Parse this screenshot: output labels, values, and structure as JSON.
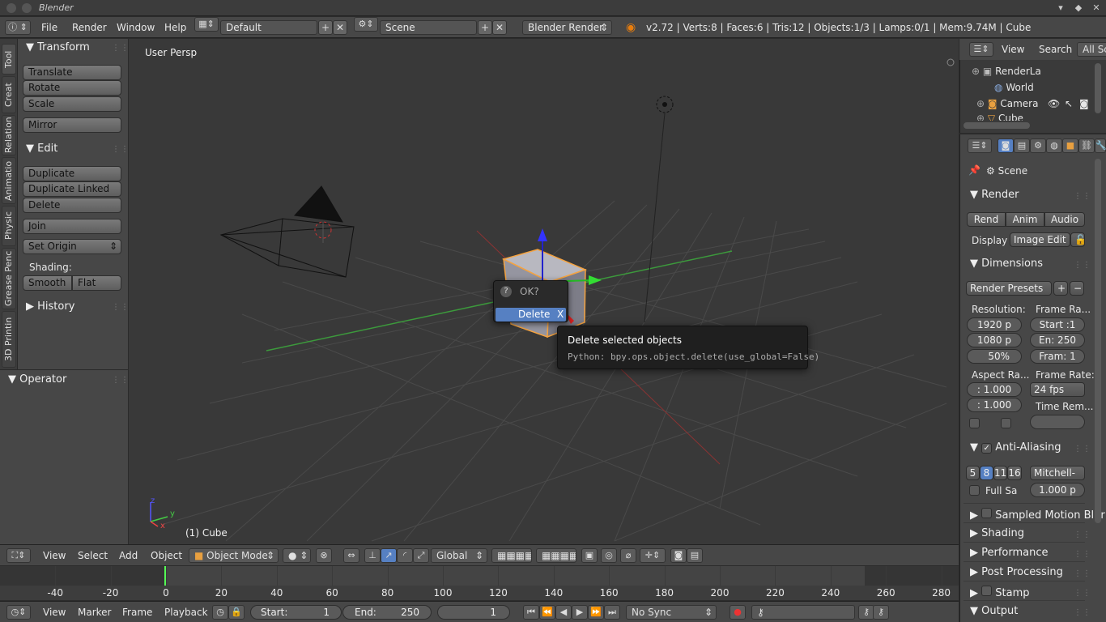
{
  "window": {
    "title": "Blender"
  },
  "info_header": {
    "menus": [
      "File",
      "Render",
      "Window",
      "Help"
    ],
    "screen_layout": "Default",
    "scene": "Scene",
    "render_engine": "Blender Render",
    "stats": "v2.72 | Verts:8 | Faces:6 | Tris:12 | Objects:1/3 | Lamps:0/1 | Mem:9.74M | Cube"
  },
  "tool_tabs": [
    "Tool",
    "Creat",
    "Relation",
    "Animatio",
    "Physic",
    "Grease Penc",
    "3D Printin"
  ],
  "tool_shelf": {
    "transform": {
      "title": "Transform",
      "buttons": [
        "Translate",
        "Rotate",
        "Scale",
        "Mirror"
      ]
    },
    "edit": {
      "title": "Edit",
      "buttons": [
        "Duplicate",
        "Duplicate Linked",
        "Delete",
        "Join"
      ],
      "set_origin": "Set Origin",
      "shading_label": "Shading:",
      "smooth": "Smooth",
      "flat": "Flat"
    },
    "history": {
      "title": "History"
    },
    "operator": {
      "title": "Operator"
    }
  },
  "viewport": {
    "view_label": "User Persp",
    "object_label": "(1) Cube",
    "axis": {
      "x": "x",
      "y": "y",
      "z": "z"
    }
  },
  "dialog": {
    "title": "OK?",
    "action": "Delete",
    "shortcut": "X"
  },
  "tooltip": {
    "title": "Delete selected objects",
    "python": "Python: bpy.ops.object.delete(use_global=False)"
  },
  "view3d_header": {
    "menus": [
      "View",
      "Select",
      "Add",
      "Object"
    ],
    "mode": "Object Mode",
    "orientation": "Global"
  },
  "timeline": {
    "ticks": [
      "-40",
      "-20",
      "0",
      "20",
      "40",
      "60",
      "80",
      "100",
      "120",
      "140",
      "160",
      "180",
      "200",
      "220",
      "240",
      "260",
      "280"
    ],
    "menus": [
      "View",
      "Marker",
      "Frame",
      "Playback"
    ],
    "start_label": "Start:",
    "start_value": "1",
    "end_label": "End:",
    "end_value": "250",
    "current_frame": "1",
    "sync": "No Sync"
  },
  "outliner": {
    "menus": [
      "View",
      "Search"
    ],
    "filter": "All Sce",
    "items": [
      "RenderLa",
      "World",
      "Camera",
      "Cube"
    ]
  },
  "properties": {
    "context": "Scene",
    "render": {
      "title": "Render",
      "buttons": [
        "Rend",
        "Anim",
        "Audio"
      ],
      "display_label": "Display",
      "display_value": "Image Edit"
    },
    "dimensions": {
      "title": "Dimensions",
      "presets": "Render Presets",
      "resolution_label": "Resolution:",
      "res_x": "1920 p",
      "res_y": "1080 p",
      "res_pct": "50%",
      "frame_range_label": "Frame Ra...",
      "start": "Start :1",
      "end": "En: 250",
      "step": "Fram: 1",
      "aspect_label": "Aspect Ra...",
      "aspect_x": ": 1.000",
      "aspect_y": ": 1.000",
      "frame_rate_label": "Frame Rate:",
      "frame_rate": "24 fps",
      "time_remap_label": "Time Rem..."
    },
    "anti_aliasing": {
      "title": "Anti-Aliasing",
      "samples": [
        "5",
        "8",
        "11",
        "16"
      ],
      "filter": "Mitchell-",
      "full_sample": "Full Sa",
      "size": "1.000 p"
    },
    "sections": [
      "Sampled Motion Blur",
      "Shading",
      "Performance",
      "Post Processing",
      "Stamp",
      "Output"
    ]
  },
  "colors": {
    "selection": "#f5a340",
    "accent_blue": "#5680c2",
    "x_axis": "#c33",
    "y_axis": "#3c3",
    "z_axis": "#33c"
  }
}
